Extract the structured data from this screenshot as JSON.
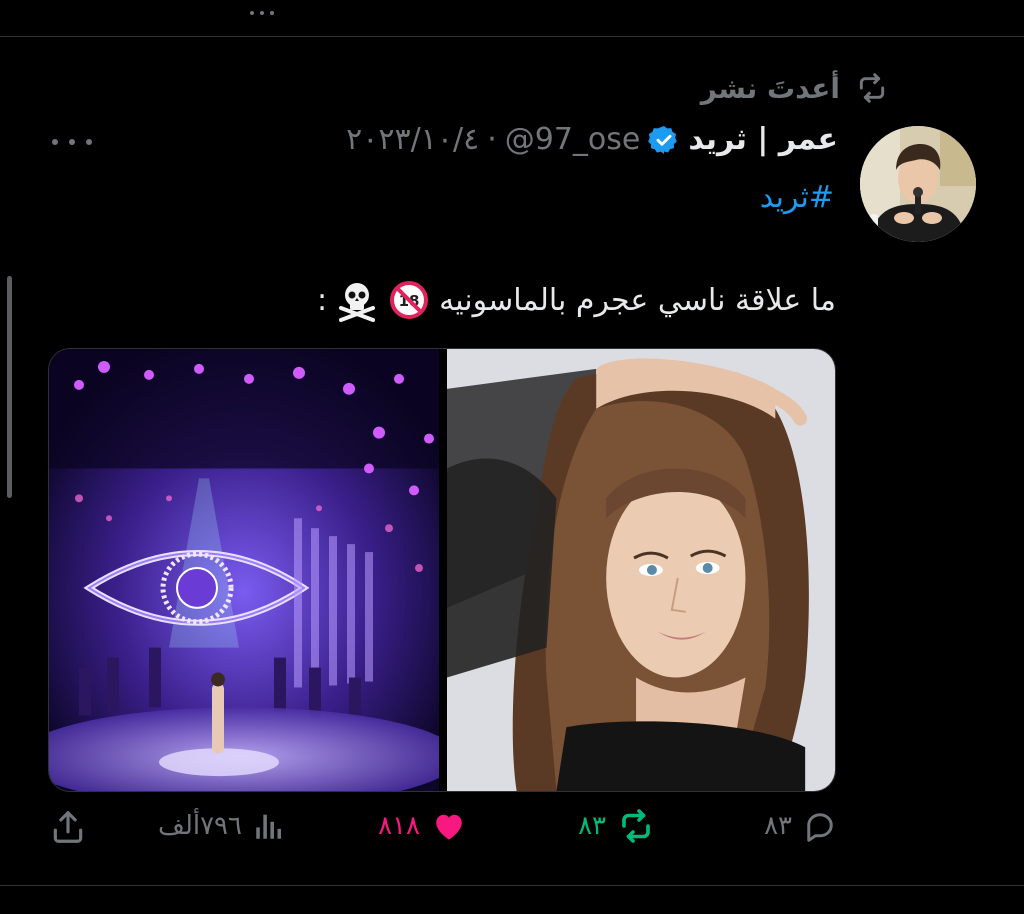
{
  "repost": {
    "label": "أعدتَ نشر",
    "icon": "retweet-icon"
  },
  "tweet": {
    "author_name": "عمر | ثريد",
    "verified": true,
    "handle": "@97_ose",
    "separator": "·",
    "date": "٢٠٢٣/١٠/٤",
    "hashtag": "#ثريد",
    "text": "ما علاقة ناسي  عجرم بالماسونيه",
    "emojis": [
      "no-one-under-eighteen-emoji",
      "skull-and-crossbones-emoji"
    ],
    "trailing": ":",
    "more_icon": "ellipsis-icon"
  },
  "media": [
    {
      "name": "concert-stage-photo",
      "description_icon": "image"
    },
    {
      "name": "portrait-photo",
      "description_icon": "image"
    }
  ],
  "actions": {
    "reply_count": "٨٣",
    "retweet_count": "٨٣",
    "like_count": "٨١٨",
    "views_count": "٧٩٦ألف",
    "icons": {
      "reply": "reply-icon",
      "retweet": "retweet-icon",
      "like": "heart-icon",
      "views": "views-icon",
      "share": "share-icon"
    }
  },
  "colors": {
    "background": "#000000",
    "text_primary": "#e7e9ea",
    "text_secondary": "#71767b",
    "link": "#1d9bf0",
    "retweet_active": "#00ba7c",
    "like_active": "#f91880",
    "divider": "#2f3336"
  }
}
